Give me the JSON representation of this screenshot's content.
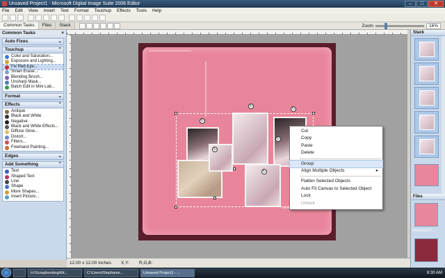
{
  "window": {
    "title": "Unsaved Project1 - Microsoft Digital Image Suite 2006 Editor",
    "controls": [
      "–",
      "□",
      "✕"
    ]
  },
  "menu": [
    "File",
    "Edit",
    "View",
    "Insert",
    "Text",
    "Format",
    "Touchup",
    "Effects",
    "Tools",
    "Help"
  ],
  "tabs": {
    "common_tasks": "Common Tasks",
    "files": "Files",
    "stack": "Stack"
  },
  "zoom": {
    "label": "Zoom",
    "value": "16%",
    "level": 0.18
  },
  "left_panel": {
    "title": "Common Tasks",
    "sections": [
      {
        "name": "Auto Fixes",
        "items": []
      },
      {
        "name": "Touchup",
        "items": [
          {
            "label": "Color and Saturation...",
            "color": "#3a7fd0"
          },
          {
            "label": "Exposure and Lighting...",
            "color": "#e0a030"
          },
          {
            "label": "Fix Red Eye...",
            "color": "#c03030",
            "selected": true
          },
          {
            "label": "Smart Erase...",
            "color": "#7aa0d0"
          },
          {
            "label": "Blending Brush...",
            "color": "#8060b0"
          },
          {
            "label": "Unsharp Mask...",
            "color": "#5080c0"
          },
          {
            "label": "Batch Edit in Mini Lab...",
            "color": "#30a050"
          }
        ]
      },
      {
        "name": "Format",
        "items": []
      },
      {
        "name": "Effects",
        "items": [
          {
            "label": "Antique",
            "color": "#8a6a40"
          },
          {
            "label": "Black and White",
            "color": "#333333"
          },
          {
            "label": "Negative",
            "color": "#202020"
          },
          {
            "label": "Black and White Effects...",
            "color": "#555555"
          },
          {
            "label": "Diffuse Glow...",
            "color": "#e0c060"
          },
          {
            "label": "Distort...",
            "color": "#6a8ad0"
          },
          {
            "label": "Filters...",
            "color": "#d05050"
          },
          {
            "label": "Freehand Painting...",
            "color": "#d07030"
          }
        ]
      },
      {
        "name": "Edges",
        "items": []
      },
      {
        "name": "Add Something",
        "items": [
          {
            "label": "Text",
            "color": "#3060c0"
          },
          {
            "label": "Shaped Text",
            "color": "#c03060"
          },
          {
            "label": "Line",
            "color": "#404040"
          },
          {
            "label": "Shape",
            "color": "#4070d0"
          },
          {
            "label": "More Shapes...",
            "color": "#d0a030"
          },
          {
            "label": "Insert Picture...",
            "color": "#50a0d0"
          }
        ]
      }
    ]
  },
  "context_menu": {
    "items": [
      {
        "label": "Cut"
      },
      {
        "label": "Copy"
      },
      {
        "label": "Paste"
      },
      {
        "label": "Delete"
      },
      {
        "separator": true
      },
      {
        "label": "Group",
        "highlighted": true
      },
      {
        "label": "Align Multiple Objects",
        "submenu": "▸"
      },
      {
        "separator": true
      },
      {
        "label": "Flatten Selected Objects"
      },
      {
        "label": "Auto Fit Canvas to Selected Object"
      },
      {
        "label": "Lock"
      },
      {
        "label": "Unlock",
        "disabled": true
      }
    ]
  },
  "right_panel": {
    "stack_title": "Stack",
    "files_title": "Files",
    "file_caption": "Unsaved P..."
  },
  "status": {
    "size": "12.00 x 12.00 inches",
    "xy": "X,Y:",
    "rgb": "R,G,B:"
  },
  "taskbar": {
    "items": [
      "H:\\Scrapbooking\\Kit...",
      "C:\\Users\\Stephanie...",
      "Unsaved Project1 - ..."
    ],
    "time": "8:30 AM"
  }
}
